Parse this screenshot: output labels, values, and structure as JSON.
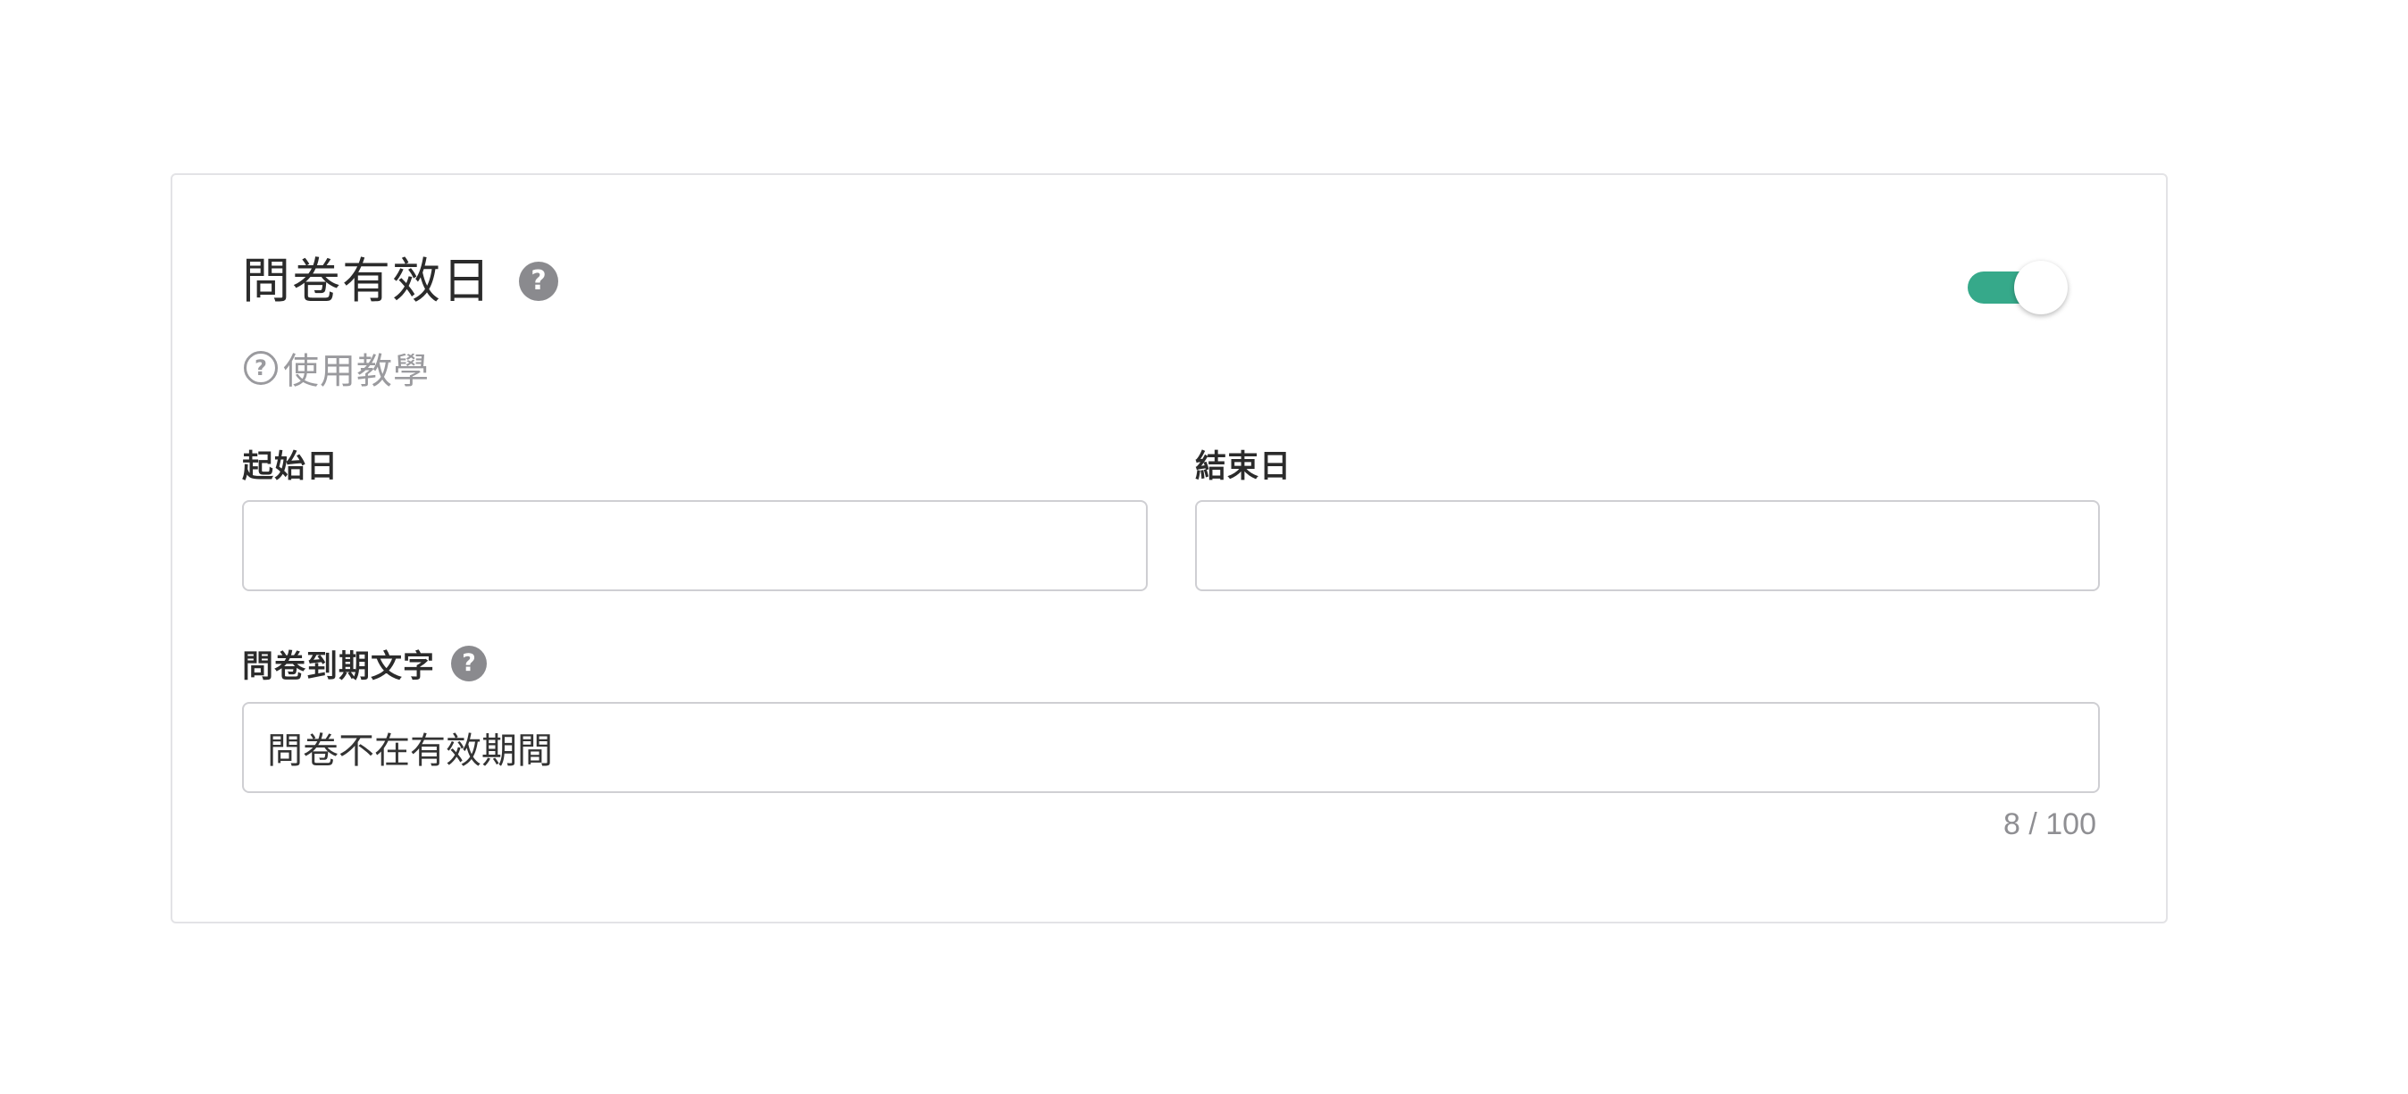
{
  "card": {
    "title": "問卷有效日",
    "help_icon": "question-mark-icon",
    "help_glyph": "?",
    "tutorial": {
      "icon": "question-circle-icon",
      "glyph": "?",
      "label": "使用教學"
    },
    "toggle": {
      "state": "on",
      "color": "#36a98a"
    }
  },
  "fields": {
    "start_date": {
      "label": "起始日",
      "value": "",
      "placeholder": ""
    },
    "end_date": {
      "label": "結束日",
      "value": "",
      "placeholder": ""
    },
    "expiry_text": {
      "label": "問卷到期文字",
      "help_icon": "question-mark-icon",
      "help_glyph": "?",
      "value": "問卷不在有效期間",
      "counter": "8 / 100"
    }
  }
}
